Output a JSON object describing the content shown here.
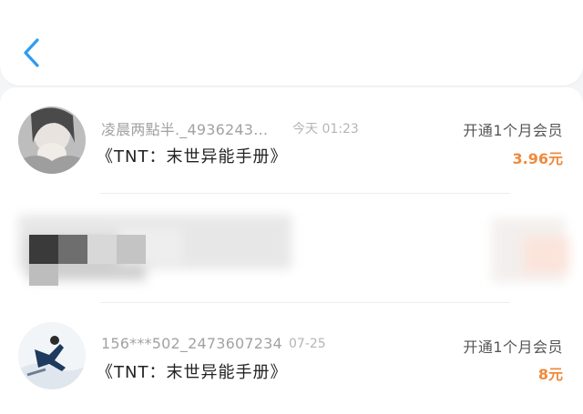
{
  "header": {
    "back_icon": "chevron-left-icon",
    "accent": "#2f9bef"
  },
  "records": [
    {
      "name": "凌晨两點半._4936243…",
      "time": "今天 01:23",
      "book": "《TNT：末世异能手册》",
      "plan": "开通1个月会员",
      "amount": "3.96元"
    },
    {
      "name": "156***502_2473607234",
      "time": "07-25",
      "book": "《TNT：末世异能手册》",
      "plan": "开通1个月会员",
      "amount": "8元"
    }
  ],
  "colors": {
    "amount": "#f08a3c",
    "name": "#a2a2a2",
    "book": "#222222"
  }
}
